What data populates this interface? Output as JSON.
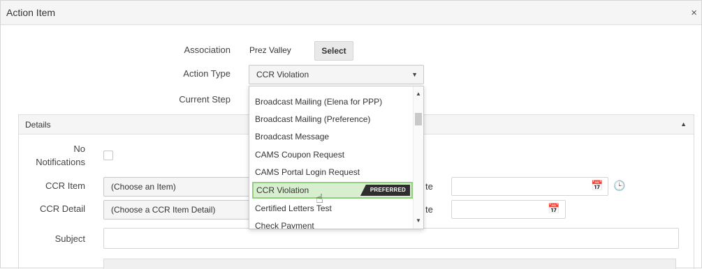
{
  "dialog": {
    "title": "Action Item",
    "close_glyph": "×"
  },
  "form": {
    "association_label": "Association",
    "association_value": "Prez Valley",
    "select_button": "Select",
    "action_type_label": "Action Type",
    "action_type_value": "CCR Violation",
    "current_step_label": "Current Step"
  },
  "details": {
    "title": "Details",
    "no_notifications_label_1": "No",
    "no_notifications_label_2": "Notifications",
    "ccr_item_label": "CCR Item",
    "ccr_item_value": "(Choose an Item)",
    "ccr_detail_label": "CCR Detail",
    "ccr_detail_value": "(Choose a CCR Item Detail)",
    "date_label_1_fragment": "te",
    "date_label_2_fragment": "te",
    "subject_label": "Subject"
  },
  "dropdown": {
    "options": [
      "Broadcast Mailing (Elena for PPP)",
      "Broadcast Mailing (Preference)",
      "Broadcast Message",
      "CAMS Coupon Request",
      "CAMS Portal Login Request",
      "CCR Violation",
      "Certified Letters Test",
      "Check Payment"
    ],
    "selected_badge": "PREFERRED"
  },
  "icons": {
    "close": "close-icon",
    "caret": "chevron-down-icon",
    "calendar": "calendar-icon",
    "clock": "clock-icon",
    "hand": "hand-pointer-icon"
  },
  "colors": {
    "selected_bg": "#d7efcf",
    "selected_border": "#8fcf7f",
    "badge_bg": "#2e2e2e"
  }
}
